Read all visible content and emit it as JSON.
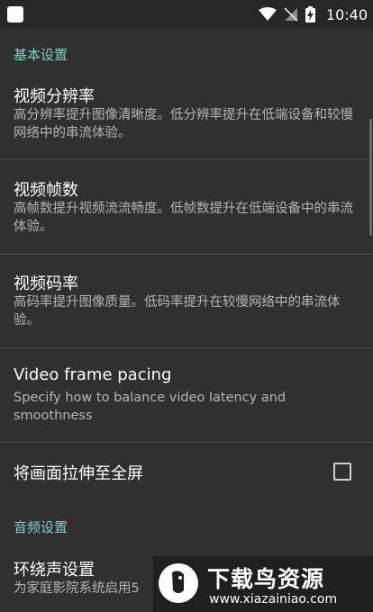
{
  "status_bar": {
    "time": "10:40",
    "icons": [
      "app-notification-icon",
      "wifi-icon",
      "no-signal-icon",
      "battery-charging-icon"
    ]
  },
  "sections": {
    "basic": {
      "header": "基本设置",
      "items": [
        {
          "title": "视频分辨率",
          "summary": "高分辨率提升图像清晰度。低分辨率提升在低端设备和较慢网络中的串流体验。"
        },
        {
          "title": "视频帧数",
          "summary": "高帧数提升视频流流畅度。低帧数提升在低端设备中的串流体验。"
        },
        {
          "title": "视频码率",
          "summary": "高码率提升图像质量。低码率提升在较慢网络中的串流体验。"
        },
        {
          "title": "Video frame pacing",
          "summary": "Specify how to balance video latency and smoothness"
        },
        {
          "title": "将画面拉伸至全屏",
          "checked": false
        }
      ]
    },
    "audio": {
      "header": "音频设置",
      "items": [
        {
          "title": "环绕声设置",
          "summary": "为家庭影院系统启用5"
        }
      ]
    }
  },
  "watermark": {
    "title": "下载鸟资源",
    "url": "www.xiazainiao.com"
  },
  "colors": {
    "background": "#303030",
    "accent": "#7fcfc2",
    "summary_text": "#b5b5b5"
  }
}
